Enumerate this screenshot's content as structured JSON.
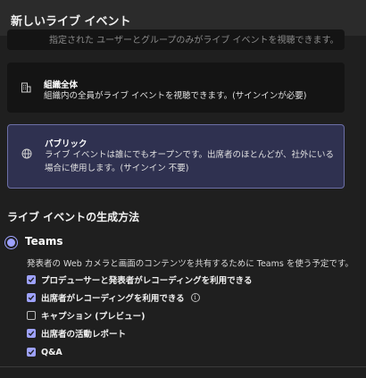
{
  "header": {
    "title": "新しいライブ イベント"
  },
  "cards": {
    "previous_cut_text": "指定された ユーザーとグループのみがライブ イベントを視聴できます。",
    "org": {
      "icon": "building-icon",
      "title": "組織全体",
      "desc": "組織内の全員がライブ イベントを視聴できます。(サインインが必要)"
    },
    "public": {
      "icon": "globe-icon",
      "title": "パブリック",
      "desc": "ライブ イベントは誰にでもオープンです。出席者のほとんどが、社外にいる場合に使用します。(サインイン 不要)"
    }
  },
  "production": {
    "section_title": "ライブ イベントの生成方法",
    "option_label": "Teams",
    "option_desc": "発表者の Web カメラと画面のコンテンツを共有するために Teams を使う予定です。",
    "options": [
      {
        "label": "プロデューサーと発表者がレコーディングを利用できる",
        "checked": true
      },
      {
        "label": "出席者がレコーディングを利用できる",
        "checked": true,
        "info": "ⓘ"
      },
      {
        "label": "キャプション (プレビュー)",
        "checked": false
      },
      {
        "label": "出席者の活動レポート",
        "checked": true
      },
      {
        "label": "Q&A",
        "checked": true
      }
    ]
  },
  "colors": {
    "accent": "#9ea2ff",
    "selected_card_bg": "#2f3150",
    "selected_card_border": "#6c6fa6"
  }
}
